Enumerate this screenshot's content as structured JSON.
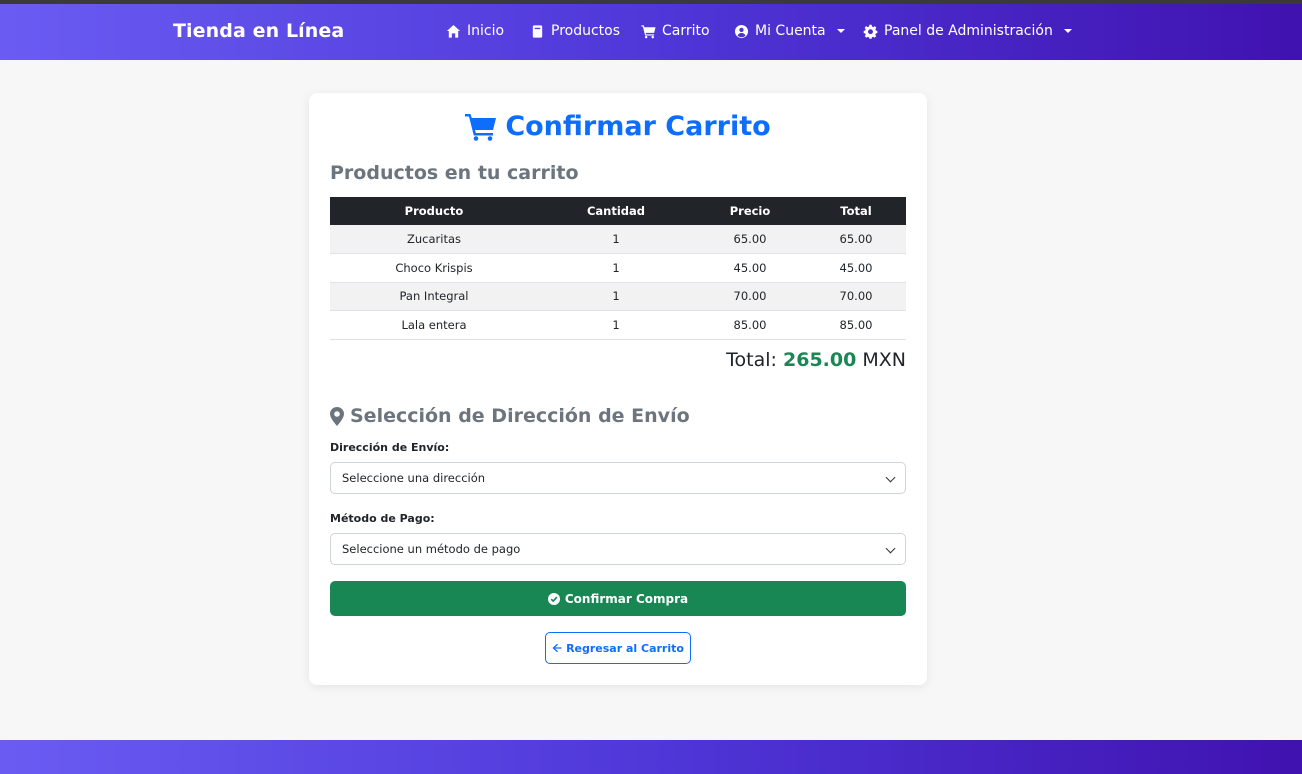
{
  "navbar": {
    "brand": "Tienda en Línea",
    "items": [
      {
        "label": "Inicio",
        "icon": "home-icon"
      },
      {
        "label": "Productos",
        "icon": "box-icon"
      },
      {
        "label": "Carrito",
        "icon": "cart-icon"
      },
      {
        "label": "Mi Cuenta",
        "icon": "user-circle-icon",
        "dropdown": true
      },
      {
        "label": "Panel de Administración",
        "icon": "gear-icon",
        "dropdown": true
      }
    ]
  },
  "page": {
    "title": "Confirmar Carrito",
    "products_heading": "Productos en tu carrito"
  },
  "cart_table": {
    "headers": [
      "Producto",
      "Cantidad",
      "Precio",
      "Total"
    ],
    "rows": [
      [
        "Zucaritas",
        "1",
        "65.00",
        "65.00"
      ],
      [
        "Choco Krispis",
        "1",
        "45.00",
        "45.00"
      ],
      [
        "Pan Integral",
        "1",
        "70.00",
        "70.00"
      ],
      [
        "Lala entera",
        "1",
        "85.00",
        "85.00"
      ]
    ]
  },
  "total": {
    "label": "Total:",
    "amount": "265.00",
    "currency": "MXN"
  },
  "shipping": {
    "heading": "Selección de Dirección de Envío",
    "address_label": "Dirección de Envío:",
    "address_selected": "Seleccione una dirección",
    "payment_label": "Método de Pago:",
    "payment_selected": "Seleccione un método de pago"
  },
  "actions": {
    "confirm_label": "Confirmar Compra",
    "back_label": "Regresar al Carrito"
  },
  "colors": {
    "primary": "#0d6efd",
    "success": "#198754",
    "nav_start": "#6a5cf3",
    "nav_end": "#4012b0"
  }
}
